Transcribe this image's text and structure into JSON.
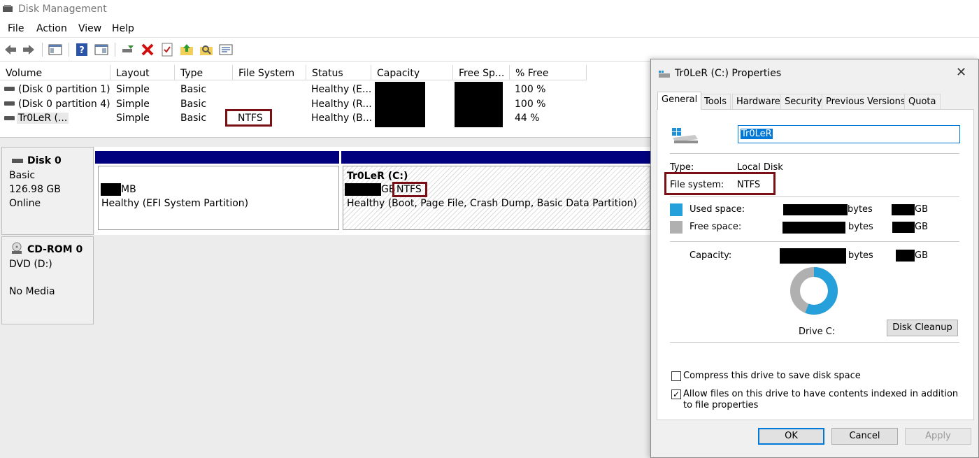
{
  "window": {
    "title": "Disk Management"
  },
  "menu": [
    "File",
    "Action",
    "View",
    "Help"
  ],
  "volume_table": {
    "columns": [
      "Volume",
      "Layout",
      "Type",
      "File System",
      "Status",
      "Capacity",
      "Free Sp...",
      "% Free"
    ],
    "rows": [
      {
        "volume": "(Disk 0 partition 1)",
        "layout": "Simple",
        "type": "Basic",
        "fs": "",
        "status": "Healthy (E...",
        "free_pct": "100 %"
      },
      {
        "volume": "(Disk 0 partition 4)",
        "layout": "Simple",
        "type": "Basic",
        "fs": "",
        "status": "Healthy (R...",
        "free_pct": "100 %"
      },
      {
        "volume": "Tr0LeR (...",
        "layout": "Simple",
        "type": "Basic",
        "fs": "NTFS",
        "status": "Healthy (B...",
        "free_pct": "44 %"
      }
    ]
  },
  "disks": [
    {
      "name": "Disk 0",
      "type": "Basic",
      "size": "126.98 GB",
      "state": "Online"
    },
    {
      "name": "CD-ROM 0",
      "type": "DVD (D:)",
      "state": "No Media"
    }
  ],
  "partitions": {
    "efi": {
      "size_unit": "MB",
      "status": "Healthy (EFI System Partition)"
    },
    "c": {
      "label": "Tr0LeR  (C:)",
      "size_unit": "GB",
      "fs": "NTFS",
      "status": "Healthy (Boot, Page File, Crash Dump, Basic Data Partition)"
    }
  },
  "dialog": {
    "title": "Tr0LeR (C:) Properties",
    "tabs": [
      "General",
      "Tools",
      "Hardware",
      "Security",
      "Previous Versions",
      "Quota"
    ],
    "name_value": "Tr0LeR",
    "type_label": "Type:",
    "type_value": "Local Disk",
    "fs_label": "File system:",
    "fs_value": "NTFS",
    "used_label": "Used space:",
    "free_label": "Free space:",
    "capacity_label": "Capacity:",
    "bytes": "bytes",
    "gb": "GB",
    "drive_label": "Drive C:",
    "cleanup": "Disk Cleanup",
    "compress": "Compress this drive to save disk space",
    "index": "Allow files on this drive to have contents indexed in addition to file properties",
    "ok": "OK",
    "cancel": "Cancel",
    "apply": "Apply",
    "used_fraction": 0.56,
    "colors": {
      "used": "#26a0da",
      "free": "#b0b0b0"
    }
  }
}
